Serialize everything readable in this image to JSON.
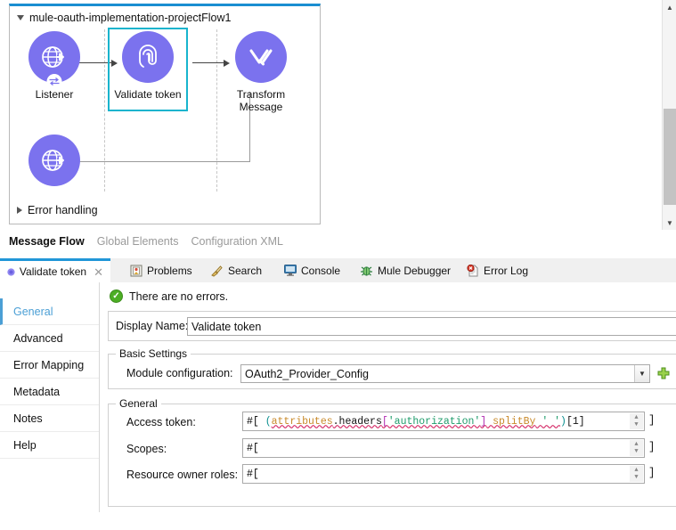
{
  "canvas": {
    "flow_name": "mule-oauth-implementation-projectFlow1",
    "expand_icon": "triangle-down-icon",
    "nodes": [
      {
        "id": "listener",
        "label": "Listener",
        "icon": "globe-arrow-icon",
        "badge": "http-exchange-icon",
        "selected": false
      },
      {
        "id": "validate",
        "label": "Validate token",
        "icon": "fingerprint-icon",
        "badge": "",
        "selected": true
      },
      {
        "id": "transform",
        "label": "Transform\nMessage",
        "icon": "transform-v-icon",
        "badge": "",
        "selected": false
      },
      {
        "id": "error-listener",
        "label": "",
        "icon": "globe-arrow-icon",
        "badge": "",
        "selected": false
      }
    ],
    "error_handling_label": "Error handling",
    "error_handling_icon": "triangle-right-icon",
    "scrollbar": {
      "up_icon": "chevron-up-icon",
      "down_icon": "chevron-down-icon"
    }
  },
  "editor_tabs": [
    {
      "label": "Message Flow",
      "active": true
    },
    {
      "label": "Global Elements",
      "active": false
    },
    {
      "label": "Configuration XML",
      "active": false
    }
  ],
  "view_tabs": [
    {
      "label": "Validate token",
      "icon": "mule-component-icon",
      "active": true,
      "closable": true,
      "close_icon": "close-icon"
    },
    {
      "label": "Problems",
      "icon": "problems-icon",
      "active": false,
      "closable": false
    },
    {
      "label": "Search",
      "icon": "search-icon",
      "active": false,
      "closable": false
    },
    {
      "label": "Console",
      "icon": "console-icon",
      "active": false,
      "closable": false
    },
    {
      "label": "Mule Debugger",
      "icon": "bug-icon",
      "active": false,
      "closable": false
    },
    {
      "label": "Error Log",
      "icon": "error-log-icon",
      "active": false,
      "closable": false
    }
  ],
  "properties": {
    "sidebar": [
      {
        "label": "General",
        "active": true
      },
      {
        "label": "Advanced",
        "active": false
      },
      {
        "label": "Error Mapping",
        "active": false
      },
      {
        "label": "Metadata",
        "active": false
      },
      {
        "label": "Notes",
        "active": false
      },
      {
        "label": "Help",
        "active": false
      }
    ],
    "status": {
      "icon": "success-check-icon",
      "text": "There are no errors."
    },
    "display_name": {
      "label": "Display Name:",
      "value": "Validate token"
    },
    "basic_settings": {
      "title": "Basic Settings",
      "module_config": {
        "label": "Module configuration:",
        "value": "OAuth2_Provider_Config",
        "dropdown_icon": "chevron-down-icon",
        "add_icon": "green-plus-icon"
      }
    },
    "general": {
      "title": "General",
      "fields": [
        {
          "label": "Access token:",
          "prefix": "#[",
          "suffix": "]",
          "tokens": [
            {
              "t": "(",
              "c": "sx-paren",
              "sq": false
            },
            {
              "t": "attributes",
              "c": "sx-id",
              "sq": true
            },
            {
              "t": ".",
              "c": "sx-field",
              "sq": true
            },
            {
              "t": "headers",
              "c": "sx-field",
              "sq": true
            },
            {
              "t": "[",
              "c": "sx-brk",
              "sq": true
            },
            {
              "t": "'authorization'",
              "c": "sx-str",
              "sq": true
            },
            {
              "t": "]",
              "c": "sx-brk",
              "sq": true
            },
            {
              "t": " ",
              "c": "sx-plain",
              "sq": true
            },
            {
              "t": "splitBy",
              "c": "sx-id",
              "sq": true
            },
            {
              "t": " ",
              "c": "sx-plain",
              "sq": true
            },
            {
              "t": "' '",
              "c": "sx-str",
              "sq": true
            },
            {
              "t": ")",
              "c": "sx-paren",
              "sq": false
            },
            {
              "t": "[1]",
              "c": "sx-num",
              "sq": false
            }
          ],
          "spinner_icon": "stepper-icon"
        },
        {
          "label": "Scopes:",
          "prefix": "#[",
          "suffix": "]",
          "tokens": [],
          "spinner_icon": "stepper-icon"
        },
        {
          "label": "Resource owner roles:",
          "prefix": "#[",
          "suffix": "]",
          "tokens": [],
          "spinner_icon": "stepper-icon"
        }
      ]
    }
  },
  "colors": {
    "node_purple": "#7b72ee",
    "selection_cyan": "#18b4cd",
    "tab_accent_blue": "#2196d8",
    "active_side_blue": "#4b9fd5",
    "success_green": "#4cae24"
  }
}
